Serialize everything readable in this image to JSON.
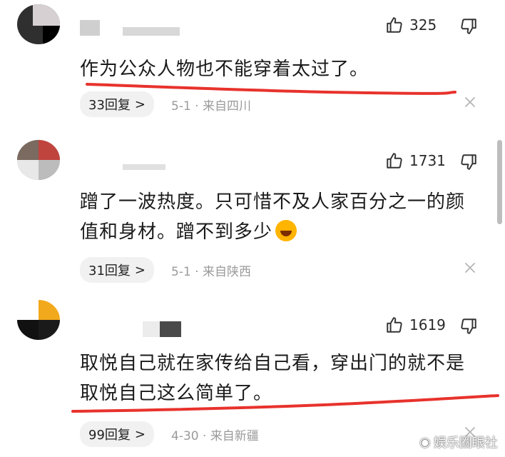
{
  "comments": [
    {
      "likes": "325",
      "text_lines": [
        "作为公众人物也不能穿着太过了。"
      ],
      "reply_label": "33回复",
      "date": "5-1",
      "location": "来自四川"
    },
    {
      "likes": "1731",
      "text_lines": [
        "蹭了一波热度。只可惜不及人家百分之一的颜",
        "值和身材。蹭不到多少"
      ],
      "reply_label": "31回复",
      "date": "5-1",
      "location": "来自陕西"
    },
    {
      "likes": "1619",
      "text_lines": [
        "取悦自己就在家传给自己看，穿出门的就不是",
        "取悦自己这么简单了。"
      ],
      "reply_label": "99回复",
      "date": "4-30",
      "location": "来自新疆"
    }
  ],
  "separator": "·",
  "reply_chevron": ">",
  "icons": {
    "like": "thumbs-up-icon",
    "dislike": "thumbs-down-icon",
    "close": "close-icon",
    "emoji": "laughing-emoji-icon"
  },
  "watermark": "娱乐圈眼社",
  "colors": {
    "underline": "#e8322c",
    "meta_text": "#9a9a9a",
    "pill_bg": "#f1f1f1"
  }
}
